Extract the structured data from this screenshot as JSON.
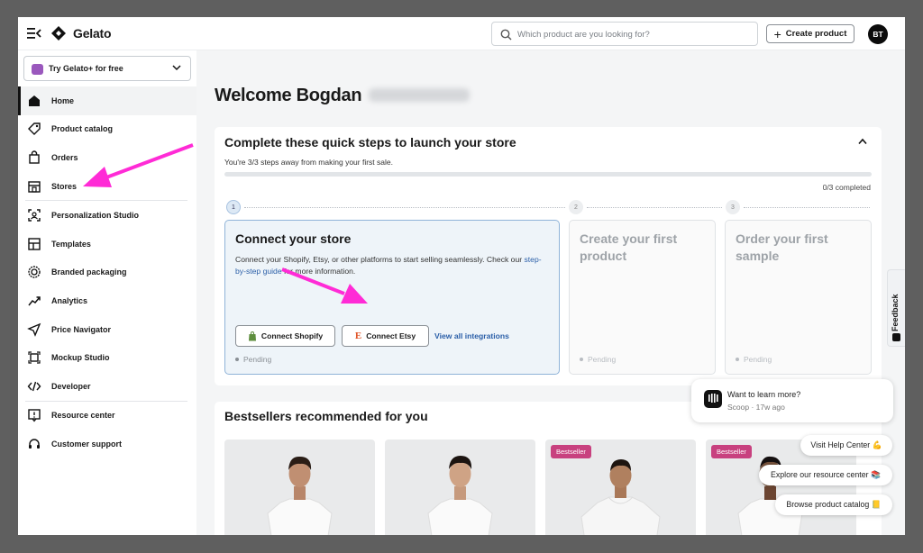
{
  "app": {
    "logo_text": "Gelato"
  },
  "topbar": {
    "search_placeholder": "Which product are you looking for?",
    "create_label": "Create product",
    "avatar_initials": "BT"
  },
  "sidebar": {
    "try_label": "Try Gelato+ for free",
    "items": [
      {
        "label": "Home",
        "icon": "home-icon"
      },
      {
        "label": "Product catalog",
        "icon": "tag-icon"
      },
      {
        "label": "Orders",
        "icon": "bag-icon"
      },
      {
        "label": "Stores",
        "icon": "store-icon"
      },
      {
        "label": "Personalization Studio",
        "icon": "personalization-icon"
      },
      {
        "label": "Templates",
        "icon": "templates-icon"
      },
      {
        "label": "Branded packaging",
        "icon": "badge-icon"
      },
      {
        "label": "Analytics",
        "icon": "chart-icon"
      },
      {
        "label": "Price Navigator",
        "icon": "navigator-icon"
      },
      {
        "label": "Mockup Studio",
        "icon": "mockup-icon"
      },
      {
        "label": "Developer",
        "icon": "code-icon"
      },
      {
        "label": "Resource center",
        "icon": "info-icon"
      },
      {
        "label": "Customer support",
        "icon": "headset-icon"
      }
    ]
  },
  "main": {
    "welcome": "Welcome Bogdan",
    "steps": {
      "title": "Complete these quick steps to launch your store",
      "subtitle": "You're 3/3 steps away from making your first sale.",
      "completed": "0/3 completed",
      "progress_fraction": 0,
      "cards": [
        {
          "number": "1",
          "title": "Connect your store",
          "desc_before": "Connect your Shopify, Etsy, or other platforms to start selling seamlessly. Check our ",
          "desc_link": "step-by-step guide",
          "desc_after": " for more information.",
          "shopify_label": "Connect Shopify",
          "etsy_label": "Connect Etsy",
          "view_all_label": "View all integrations",
          "status": "Pending"
        },
        {
          "number": "2",
          "title": "Create your first product",
          "status": "Pending"
        },
        {
          "number": "3",
          "title": "Order your first sample",
          "status": "Pending"
        }
      ]
    },
    "bestsellers": {
      "title": "Bestsellers recommended for you",
      "badge": "Bestseller"
    },
    "feedback_label": "Feedback"
  },
  "chat": {
    "title": "Want to learn more?",
    "meta": "Scoop · 17w ago",
    "quick_replies": [
      "Visit Help Center 💪",
      "Explore our resource center 📚",
      "Browse product catalog 📒"
    ]
  },
  "colors": {
    "accent_arrow": "#ff2bd6",
    "link": "#2b5fa8",
    "badge": "#c8417f"
  }
}
